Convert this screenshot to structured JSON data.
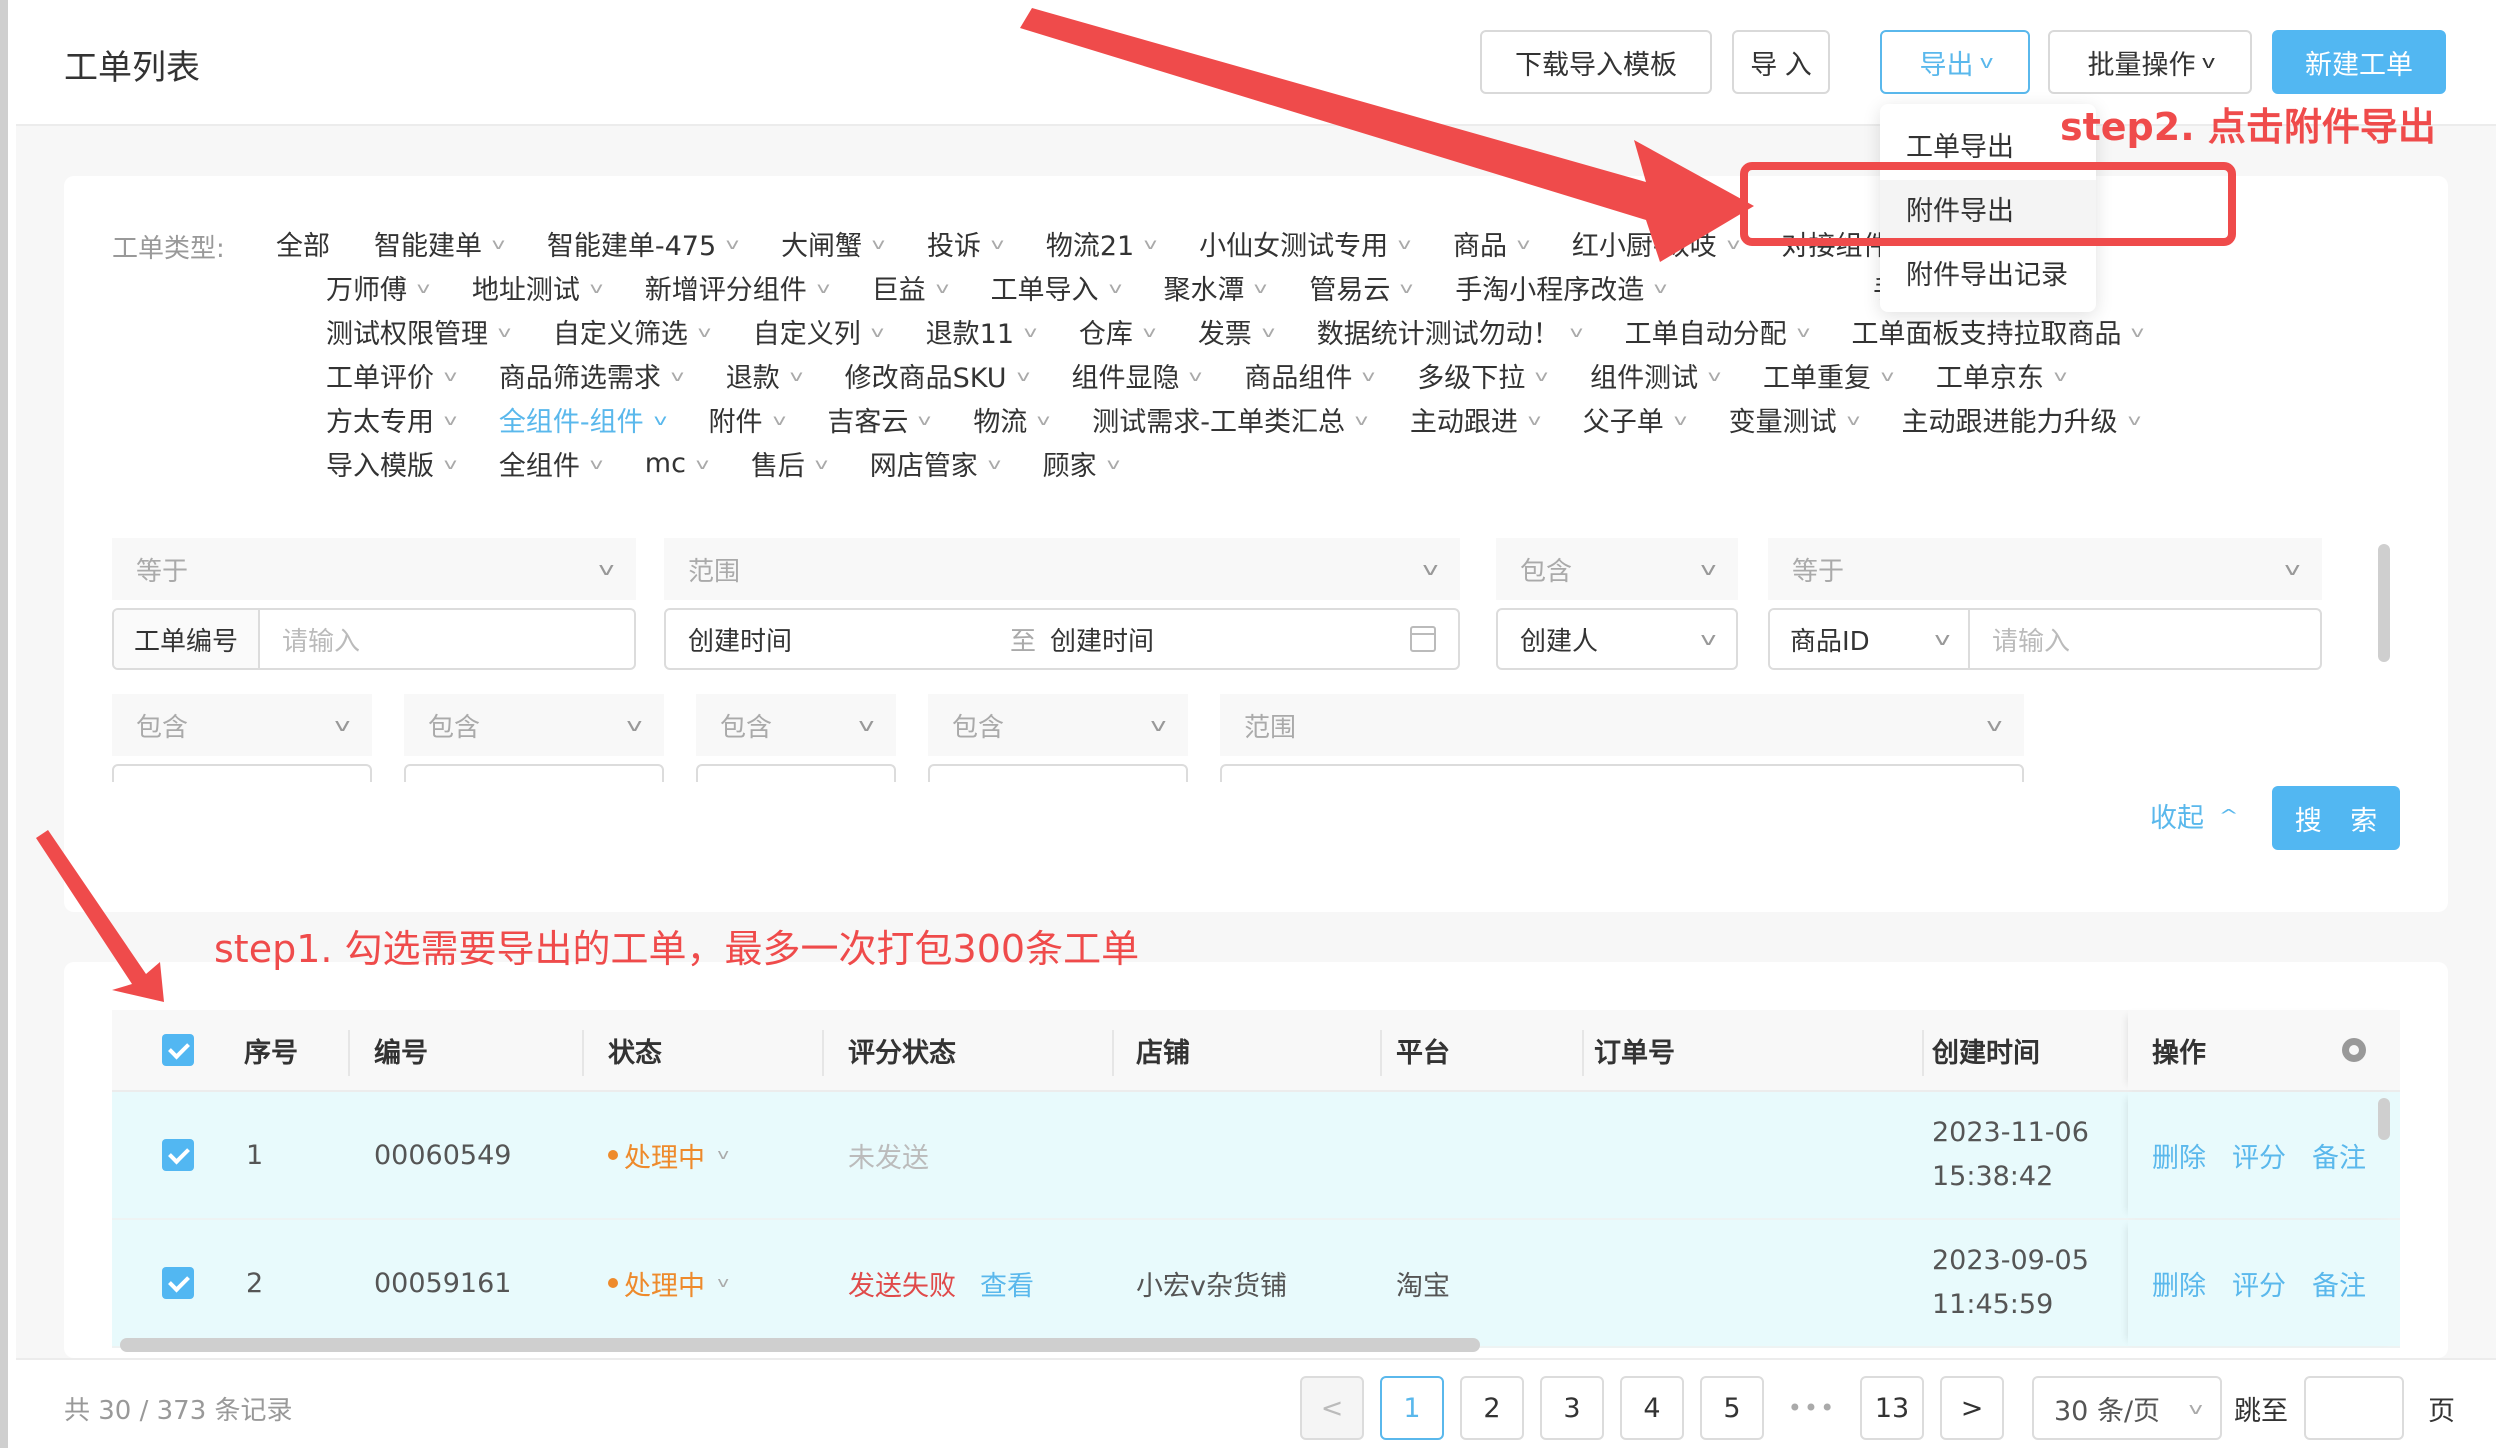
{
  "header": {
    "title": "工单列表",
    "buttons": {
      "download_template": "下载导入模板",
      "import": "导 入",
      "export": "导出",
      "batch": "批量操作",
      "create": "新建工单"
    }
  },
  "export_menu": {
    "items": [
      "工单导出",
      "附件导出",
      "附件导出记录"
    ],
    "hovered": "附件导出"
  },
  "annotations": {
    "step1": "step1. 勾选需要导出的工单，最多一次打包300条工单",
    "step2": "step2. 点击附件导出",
    "highlight_color": "#ef4b4b"
  },
  "categories": {
    "label": "工单类型:",
    "active": "全组件-组件",
    "rows": [
      [
        "全部",
        "智能建单",
        "智能建单-475",
        "大闸蟹",
        "投诉",
        "物流21",
        "小仙女测试专用",
        "商品",
        "红小厨-数吱",
        "对接组件需求"
      ],
      [
        "万师傅",
        "地址测试",
        "新增评分组件",
        "巨益",
        "工单导入",
        "聚水潭",
        "管易云",
        "手淘小程序改造",
        "",
        "手淘小程序"
      ],
      [
        "测试权限管理",
        "自定义筛选",
        "自定义列",
        "退款11",
        "仓库",
        "发票",
        "数据统计测试勿动！",
        "工单自动分配",
        "工单面板支持拉取商品"
      ],
      [
        "工单评价",
        "商品筛选需求",
        "退款",
        "修改商品SKU",
        "组件显隐",
        "商品组件",
        "多级下拉",
        "组件测试",
        "工单重复",
        "工单京东"
      ],
      [
        "方太专用",
        "全组件-组件",
        "附件",
        "吉客云",
        "物流",
        "测试需求-工单类汇总",
        "主动跟进",
        "父子单",
        "变量测试",
        "主动跟进能力升级"
      ],
      [
        "导入模版",
        "全组件",
        "mc",
        "售后",
        "网店管家",
        "顾家"
      ]
    ]
  },
  "filters": {
    "row1": [
      {
        "operator": "等于",
        "field": "工单编号",
        "placeholder": "请输入"
      },
      {
        "operator": "范围",
        "start": "创建时间",
        "sep": "至",
        "end": "创建时间"
      },
      {
        "operator": "包含",
        "field": "创建人"
      },
      {
        "operator": "等于",
        "field": "商品ID",
        "placeholder": "请输入"
      }
    ],
    "row2_operators": [
      "包含",
      "包含",
      "包含",
      "包含",
      "范围"
    ],
    "collapse": "收起",
    "search": "搜 索"
  },
  "table": {
    "columns": [
      "序号",
      "编号",
      "状态",
      "评分状态",
      "店铺",
      "平台",
      "订单号",
      "创建时间",
      "操作"
    ],
    "rows": [
      {
        "index": "1",
        "id": "00060549",
        "status": "处理中",
        "rating_status": "未发送",
        "rating_link": "",
        "shop": "",
        "platform": "",
        "order_no": "",
        "created_date": "2023-11-06",
        "created_time": "15:38:42",
        "checked": true
      },
      {
        "index": "2",
        "id": "00059161",
        "status": "处理中",
        "rating_status": "发送失败",
        "rating_link": "查看",
        "shop": "小宏v杂货铺",
        "platform": "淘宝",
        "order_no": "",
        "created_date": "2023-09-05",
        "created_time": "11:45:59",
        "checked": true
      }
    ],
    "actions": [
      "删除",
      "评分",
      "备注"
    ]
  },
  "pagination": {
    "total_text": "共 30 / 373 条记录",
    "pages": [
      "1",
      "2",
      "3",
      "4",
      "5"
    ],
    "ellipsis": "•••",
    "last_page": "13",
    "current": "1",
    "page_size": "30 条/页",
    "jump_label": "跳至",
    "page_label": "页"
  },
  "colors": {
    "primary": "#52b7f2",
    "status_processing": "#ee8a2b",
    "fail": "#e04a4a",
    "row_selected": "#e8fafc"
  }
}
